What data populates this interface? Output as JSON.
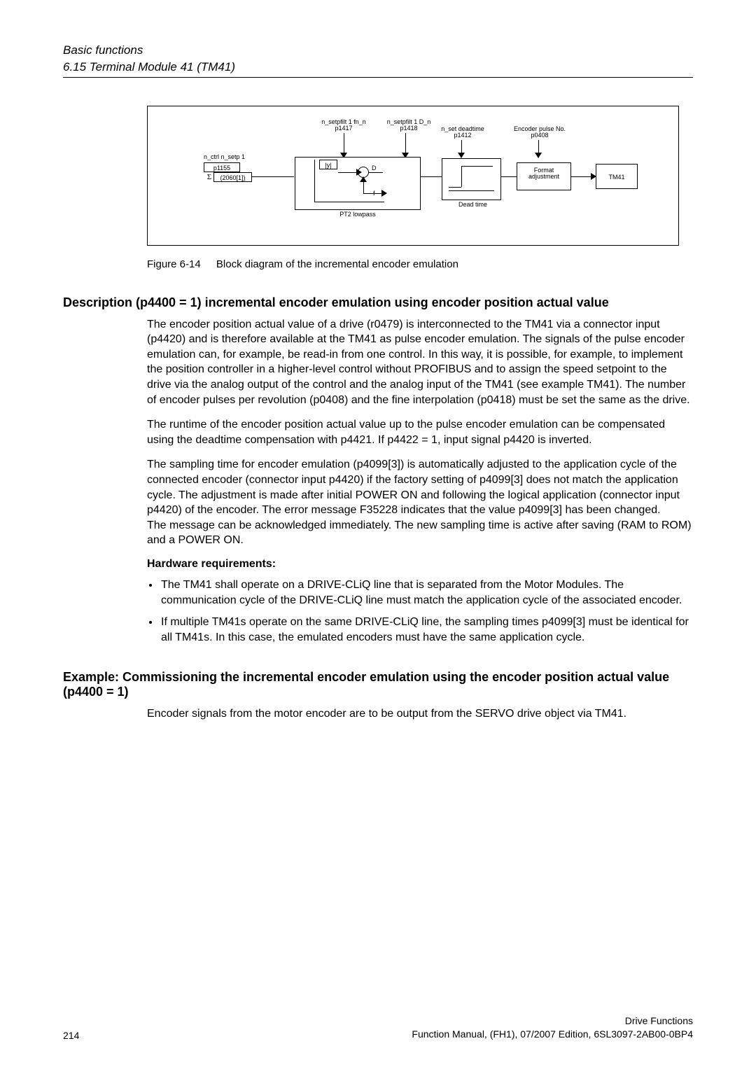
{
  "header": {
    "line1": "Basic functions",
    "line2": "6.15 Terminal Module 41 (TM41)"
  },
  "diagram": {
    "labels": {
      "input_top": "n_ctrl n_setp 1",
      "input_p": "p1155",
      "input_src": "(2060[1])",
      "filt1_top": "n_setpfilt 1 fn_n",
      "filt1_p": "p1417",
      "filt2_top": "n_setpfilt 1 D_n",
      "filt2_p": "p1418",
      "deadtime_top": "n_set deadtime",
      "deadtime_p": "p1412",
      "pulse_top": "Encoder pulse No.",
      "pulse_p": "p0408",
      "pt2_label": "PT2 lowpass",
      "deadtime_box": "Dead time",
      "format_box_l1": "Format",
      "format_box_l2": "adjustment",
      "tm41": "TM41",
      "y_abs": "|y|",
      "D": "D",
      "f": "f",
      "sigma": "Σ"
    }
  },
  "caption": {
    "fignum": "Figure 6-14",
    "text": "Block diagram of the incremental encoder emulation"
  },
  "section1": {
    "title": "Description (p4400 = 1) incremental encoder emulation using encoder position actual value",
    "p1": "The encoder position actual value of a drive (r0479) is interconnected to the TM41 via a connector input (p4420) and is therefore available at the TM41 as pulse encoder emulation. The signals of the pulse encoder emulation can, for example, be read-in from one control. In this way, it is possible, for example, to implement the position controller in a higher-level control without PROFIBUS and to assign the speed setpoint to the drive via the analog output of the control and the analog input of the TM41 (see example TM41). The number of encoder pulses per revolution (p0408) and the fine interpolation (p0418) must be set the same as the drive.",
    "p2": "The runtime of the encoder position actual value up to the pulse encoder emulation can be compensated using the deadtime compensation with p4421. If p4422 = 1, input signal p4420 is inverted.",
    "p3a": "The sampling time for encoder emulation (p4099[3]) is automatically adjusted to the application cycle of the connected encoder (connector input p4420) if the factory setting of p4099[3] does not match the application cycle. The adjustment is made after initial POWER ON and following the logical application (connector input p4420) of the encoder. The error message F35228 indicates that the value p4099[3] has been changed.",
    "p3b": "The message can be acknowledged immediately. The new sampling time is active after saving (RAM to ROM) and a POWER ON.",
    "hw_req_head": "Hardware requirements:",
    "bullet1": "The TM41 shall operate on a DRIVE-CLiQ line that is separated from the Motor Modules. The communication cycle of the DRIVE-CLiQ line must match the application cycle of the associated encoder.",
    "bullet2": "If multiple TM41s operate on the same DRIVE-CLiQ line, the sampling times p4099[3] must be identical for all TM41s. In this case, the emulated encoders must have the same application cycle."
  },
  "section2": {
    "title": "Example: Commissioning the incremental encoder emulation using the encoder position actual value (p4400 = 1)",
    "p1": "Encoder signals from the motor encoder are to be output from the SERVO drive object via TM41."
  },
  "footer": {
    "page": "214",
    "right1": "Drive Functions",
    "right2": "Function Manual, (FH1), 07/2007 Edition, 6SL3097-2AB00-0BP4"
  }
}
